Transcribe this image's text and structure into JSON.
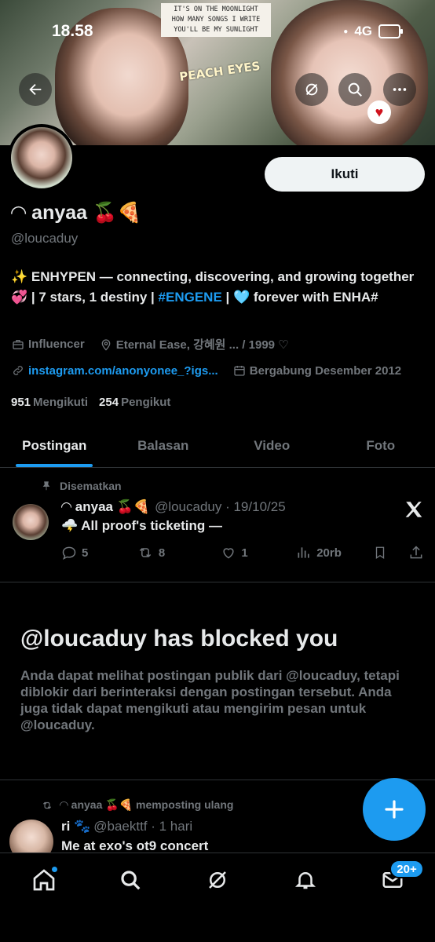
{
  "status_bar": {
    "time": "18.58",
    "network": "4G"
  },
  "profile": {
    "display_name": "◠ anyaa 🍒🍕",
    "handle": "@loucaduy",
    "bio_prefix": "✨ ENHYPEN — connecting, discovering, and growing together 💞 | 7 stars, 1 destiny | ",
    "bio_hashtag": "#ENGENE",
    "bio_suffix": " | 🩵 forever with ENHA#",
    "category": "Influencer",
    "location": "Eternal Ease, 강혜원 ... / 1999 ♡",
    "website": "instagram.com/anonyonee_?igs...",
    "joined": "Bergabung Desember 2012",
    "following_count": "951",
    "following_label": "Mengikuti",
    "followers_count": "254",
    "followers_label": "Pengikut",
    "follow_button": "Ikuti"
  },
  "banner": {
    "quote_lines": [
      "IT'S ON THE MOONLIGHT",
      "HOW MANY SONGS I WRITE",
      "YOU'LL BE MY SUNLIGHT"
    ],
    "sticker": "PEACH EYES"
  },
  "tabs": [
    {
      "label": "Postingan",
      "active": true
    },
    {
      "label": "Balasan",
      "active": false
    },
    {
      "label": "Video",
      "active": false
    },
    {
      "label": "Foto",
      "active": false
    }
  ],
  "pinned_post": {
    "pinned_label": "Disematkan",
    "name": "◠ anyaa 🍒🍕",
    "handle_date": "@loucaduy · 19/10/25",
    "text": "🌩️ All proof's ticketing —",
    "replies": "5",
    "reposts": "8",
    "likes": "1",
    "views": "20rb"
  },
  "blocked": {
    "title": "@loucaduy has blocked you",
    "body": "Anda dapat melihat postingan publik dari @loucaduy, tetapi diblokir dari berinteraksi dengan postingan tersebut. Anda juga tidak dapat mengikuti atau mengirim pesan untuk @loucaduy."
  },
  "repost": {
    "label": "◠ anyaa 🍒🍕  memposting ulang",
    "name": "ri 🐾",
    "handle_time": "@baekttf · 1 hari",
    "text": "Me at exo's ot9 concert"
  },
  "bottom_nav": {
    "mail_badge": "20+"
  },
  "colors": {
    "accent": "#1d9bf0",
    "background": "#000000",
    "muted": "#71767b",
    "text": "#e7e9ea"
  }
}
